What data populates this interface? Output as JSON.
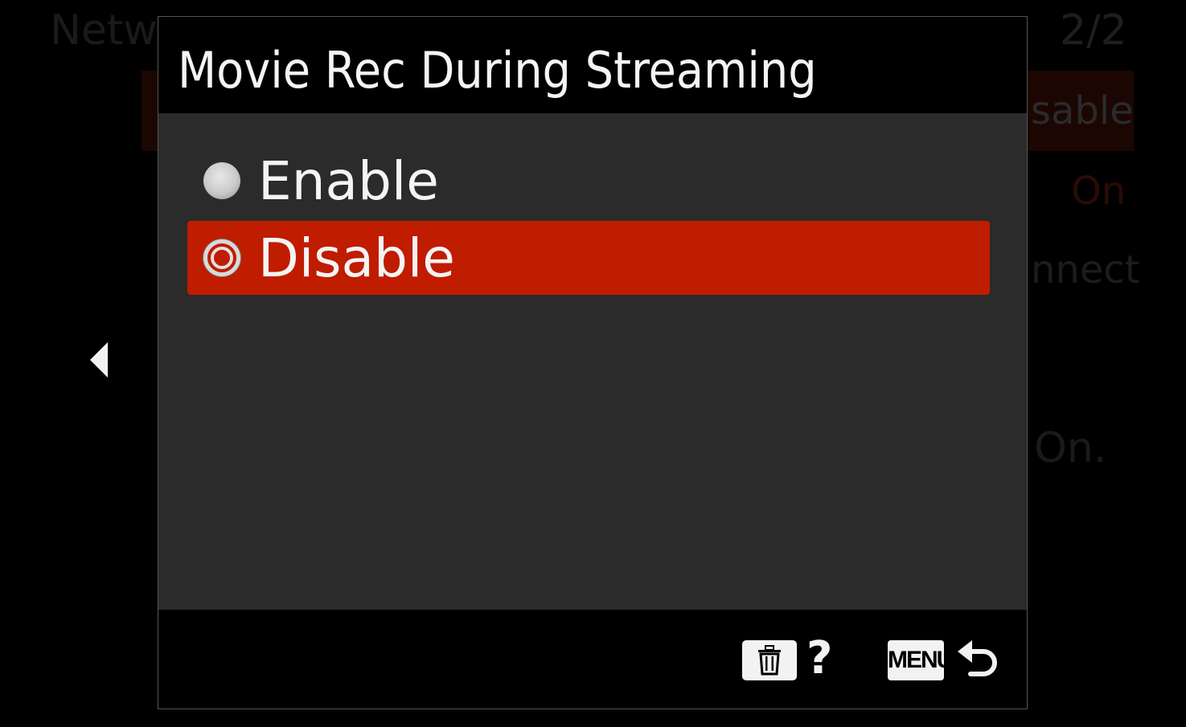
{
  "background": {
    "title_fragment": "Netwo",
    "page_indicator": "2/2",
    "value_1": "sable",
    "value_2": "On",
    "value_3": "nnect",
    "value_4": "On."
  },
  "dialog": {
    "title": "Movie Rec During Streaming",
    "options": [
      {
        "label": "Enable",
        "selected": false
      },
      {
        "label": "Disable",
        "selected": true
      }
    ],
    "footer": {
      "help_label": "?",
      "menu_label": "MENU"
    }
  },
  "colors": {
    "highlight": "#c01c00",
    "body_bg": "#2b2b2b",
    "text": "#f4f4f4"
  }
}
